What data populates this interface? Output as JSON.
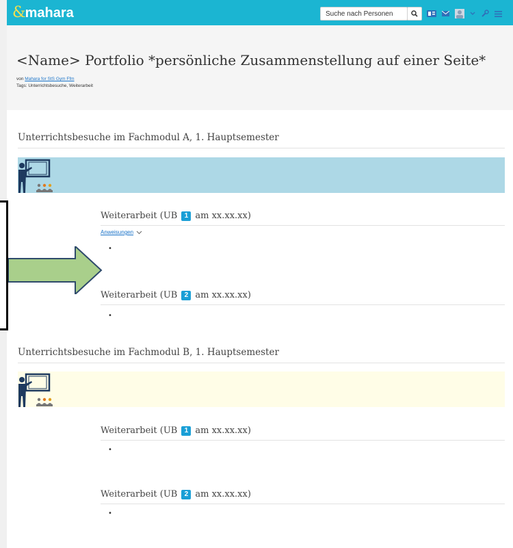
{
  "topbar": {
    "logo_text": "mahara",
    "search_placeholder": "Suche nach Personen",
    "icons": [
      "search-icon",
      "content-icon",
      "mail-icon",
      "user-avatar-icon",
      "chevron-down-icon",
      "admin-wrench-icon",
      "menu-icon"
    ],
    "color": "#1bb5d2"
  },
  "page": {
    "title": "<Name> Portfolio *persönliche Zusammenstellung auf einer Seite*",
    "by_prefix": "von ",
    "by_author": "Mahara for StS Gym Ffm",
    "tags": "Tags: Unterrichtsbesuche, Weiterarbeit"
  },
  "sections": [
    {
      "title": "Unterrichtsbesuche im Fachmodul A, 1. Hauptsemester",
      "banner_color": "#add8e6",
      "items": [
        {
          "prefix": "Weiterarbeit (UB",
          "badge": "1",
          "suffix": "am xx.xx.xx)"
        },
        {
          "prefix": "Weiterarbeit (UB",
          "badge": "2",
          "suffix": "am xx.xx.xx)"
        }
      ]
    },
    {
      "title": "Unterrichtsbesuche im Fachmodul B, 1. Hauptsemester",
      "banner_color": "#fffde7",
      "items": [
        {
          "prefix": "Weiterarbeit (UB",
          "badge": "1",
          "suffix": "am xx.xx.xx)"
        },
        {
          "prefix": "Weiterarbeit (UB",
          "badge": "2",
          "suffix": "am xx.xx.xx)"
        }
      ]
    }
  ],
  "instructions_label": "Anweisungen",
  "bullet": "•",
  "annotation": {
    "arrow_color": "#a9cf8b"
  }
}
